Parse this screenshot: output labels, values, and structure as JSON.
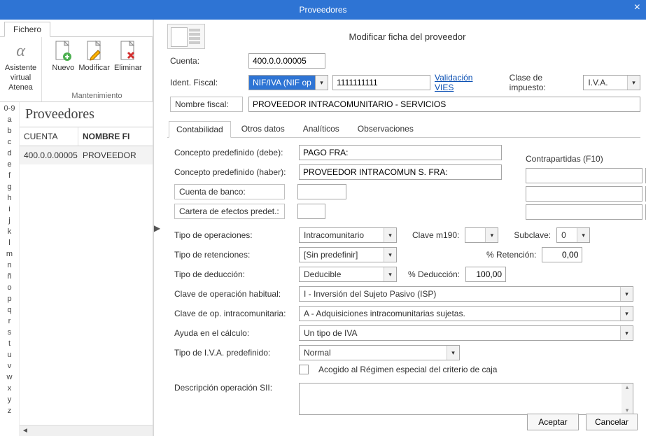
{
  "window": {
    "title": "Proveedores"
  },
  "ribbon": {
    "tab": "Fichero",
    "groups": [
      {
        "label": "Asistente virtual Atenea",
        "items": [
          {
            "label1": "Asistente",
            "label2": "virtual",
            "label3": "Atenea"
          }
        ]
      },
      {
        "label": "Mantenimiento",
        "items": [
          {
            "label": "Nuevo"
          },
          {
            "label": "Modificar"
          },
          {
            "label": "Eliminar"
          }
        ]
      }
    ]
  },
  "alpha": [
    "0-9",
    "a",
    "b",
    "c",
    "d",
    "e",
    "f",
    "g",
    "h",
    "i",
    "j",
    "k",
    "l",
    "m",
    "n",
    "ñ",
    "o",
    "p",
    "q",
    "r",
    "s",
    "t",
    "u",
    "v",
    "w",
    "x",
    "y",
    "z"
  ],
  "list": {
    "title": "Proveedores",
    "columns": [
      "CUENTA",
      "NOMBRE FI"
    ],
    "rows": [
      {
        "cuenta": "400.0.0.00005",
        "nombre": "PROVEEDOR"
      }
    ]
  },
  "form": {
    "title": "Modificar ficha del proveedor",
    "labels": {
      "cuenta": "Cuenta:",
      "ident_fiscal": "Ident. Fiscal:",
      "nombre_fiscal": "Nombre fiscal:",
      "validacion_vies": "Validación VIES",
      "clase_impuesto": "Clase de impuesto:"
    },
    "cuenta": "400.0.0.00005",
    "ident_tipo": "NIF/IVA (NIF ope)",
    "ident_num": "1111111111",
    "clase_impuesto": "I.V.A.",
    "nombre_fiscal": "PROVEEDOR INTRACOMUNITARIO - SERVICIOS",
    "tabs": [
      "Contabilidad",
      "Otros datos",
      "Analíticos",
      "Observaciones"
    ],
    "active_tab": 0,
    "contab": {
      "labels": {
        "concepto_debe": "Concepto predefinido (debe):",
        "concepto_haber": "Concepto predefinido (haber):",
        "cuenta_banco": "Cuenta de banco:",
        "cartera_efectos": "Cartera de efectos predet.:",
        "tipo_operaciones": "Tipo de operaciones:",
        "clave_m190": "Clave m190:",
        "subclave": "Subclave:",
        "tipo_retenciones": "Tipo de retenciones:",
        "pct_retencion": "% Retención:",
        "tipo_deduccion": "Tipo de deducción:",
        "pct_deduccion": "% Deducción:",
        "clave_op_habitual": "Clave de operación habitual:",
        "clave_op_intracom": "Clave de op. intracomunitaria:",
        "ayuda_calculo": "Ayuda en el cálculo:",
        "tipo_iva_predef": "Tipo de I.V.A. predefinido:",
        "acogido_caja": "Acogido al Régimen especial del criterio de caja",
        "desc_sii": "Descripción operación SII:",
        "contrapartidas": "Contrapartidas (F10)"
      },
      "concepto_debe": "PAGO FRA:",
      "concepto_haber": "PROVEEDOR INTRACOMUN S. FRA:",
      "cuenta_banco": "",
      "cartera_efectos": "",
      "tipo_operaciones": "Intracomunitario",
      "clave_m190": "",
      "subclave": "0",
      "tipo_retenciones": "[Sin predefinir]",
      "pct_retencion": "0,00",
      "tipo_deduccion": "Deducible",
      "pct_deduccion": "100,00",
      "clave_op_habitual": "I - Inversión del Sujeto Pasivo (ISP)",
      "clave_op_intracom": "A - Adquisiciones intracomunitarias sujetas.",
      "ayuda_calculo": "Un tipo de IVA",
      "tipo_iva_predef": "Normal",
      "desc_sii": ""
    },
    "footer": {
      "accept": "Aceptar",
      "cancel": "Cancelar"
    }
  }
}
